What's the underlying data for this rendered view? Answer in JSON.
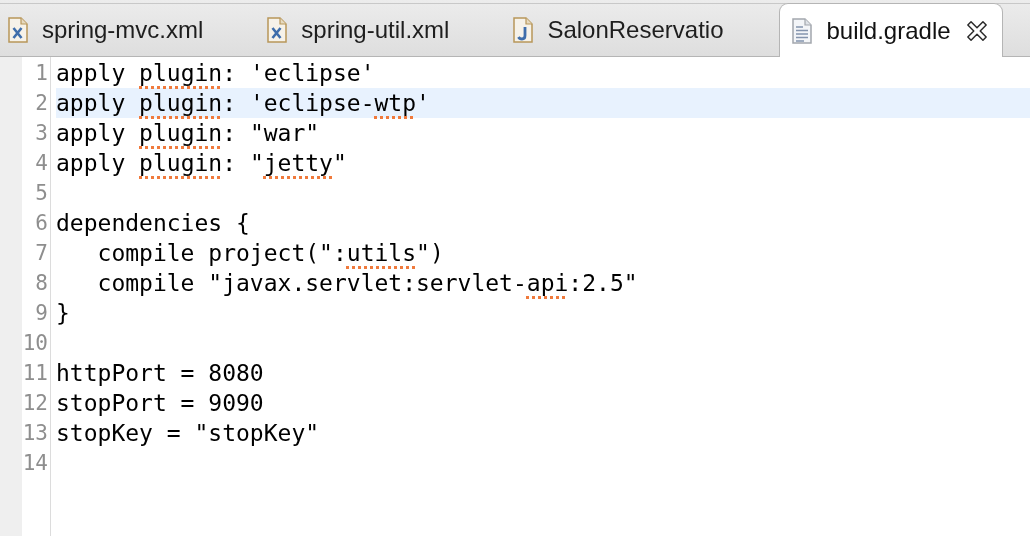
{
  "tabs": [
    {
      "label": "spring-mvc.xml",
      "kind": "xml",
      "selected": false
    },
    {
      "label": "spring-util.xml",
      "kind": "xml",
      "selected": false
    },
    {
      "label": "SalonReservatio",
      "kind": "java",
      "selected": false
    },
    {
      "label": "build.gradle",
      "kind": "text",
      "selected": true
    }
  ],
  "editor": {
    "lines": [
      {
        "number": "1",
        "current": false,
        "segments": [
          {
            "text": "apply ",
            "misspelled": false
          },
          {
            "text": "plugin",
            "misspelled": true
          },
          {
            "text": ": 'eclipse'",
            "misspelled": false
          }
        ]
      },
      {
        "number": "2",
        "current": true,
        "segments": [
          {
            "text": "apply ",
            "misspelled": false
          },
          {
            "text": "plugin",
            "misspelled": true
          },
          {
            "text": ": 'eclipse-",
            "misspelled": false
          },
          {
            "text": "wtp",
            "misspelled": true
          },
          {
            "text": "'",
            "misspelled": false
          }
        ]
      },
      {
        "number": "3",
        "current": false,
        "segments": [
          {
            "text": "apply ",
            "misspelled": false
          },
          {
            "text": "plugin",
            "misspelled": true
          },
          {
            "text": ": \"war\"",
            "misspelled": false
          }
        ]
      },
      {
        "number": "4",
        "current": false,
        "segments": [
          {
            "text": "apply ",
            "misspelled": false
          },
          {
            "text": "plugin",
            "misspelled": true
          },
          {
            "text": ": \"",
            "misspelled": false
          },
          {
            "text": "jetty",
            "misspelled": true
          },
          {
            "text": "\"",
            "misspelled": false
          }
        ]
      },
      {
        "number": "5",
        "current": false
      },
      {
        "number": "6",
        "current": false,
        "segments": [
          {
            "text": "dependencies {",
            "misspelled": false
          }
        ]
      },
      {
        "number": "7",
        "current": false,
        "segments": [
          {
            "text": "   compile project(\":",
            "misspelled": false
          },
          {
            "text": "utils",
            "misspelled": true
          },
          {
            "text": "\")",
            "misspelled": false
          }
        ]
      },
      {
        "number": "8",
        "current": false,
        "segments": [
          {
            "text": "   compile \"javax.servlet:servlet-",
            "misspelled": false
          },
          {
            "text": "api",
            "misspelled": true
          },
          {
            "text": ":2.5\"",
            "misspelled": false
          }
        ]
      },
      {
        "number": "9",
        "current": false,
        "segments": [
          {
            "text": "}",
            "misspelled": false
          }
        ]
      },
      {
        "number": "10",
        "current": false
      },
      {
        "number": "11",
        "current": false,
        "segments": [
          {
            "text": "httpPort = 8080",
            "misspelled": false
          }
        ]
      },
      {
        "number": "12",
        "current": false,
        "segments": [
          {
            "text": "stopPort = 9090",
            "misspelled": false
          }
        ]
      },
      {
        "number": "13",
        "current": false,
        "segments": [
          {
            "text": "stopKey = \"stopKey\"",
            "misspelled": false
          }
        ]
      },
      {
        "number": "14",
        "current": false
      }
    ]
  }
}
